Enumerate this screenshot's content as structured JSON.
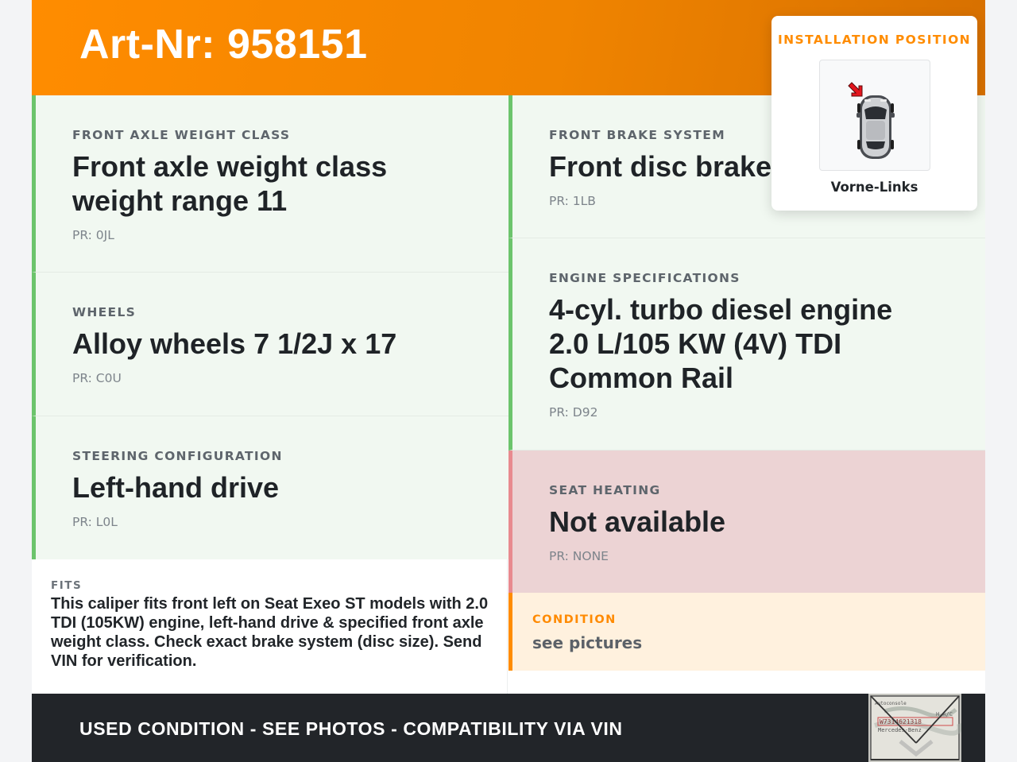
{
  "header": {
    "art_number": "Art-Nr: 958151"
  },
  "specs": [
    {
      "label": "FRONT AXLE WEIGHT CLASS",
      "value": "Front axle weight class weight range 11",
      "pr": "PR: 0JL"
    },
    {
      "label": "WHEELS",
      "value": "Alloy wheels 7 1/2J x 17",
      "pr": "PR: C0U"
    },
    {
      "label": "STEERING CONFIGURATION",
      "value": "Left-hand drive",
      "pr": "PR: L0L"
    },
    {
      "label": "FRONT BRAKE SYSTEM",
      "value": "Front disc brakes",
      "pr": "PR: 1LB"
    },
    {
      "label": "ENGINE SPECIFICATIONS",
      "value": "4-cyl. turbo diesel engine 2.0 L/105 KW (4V) TDI Common Rail",
      "pr": "PR: D92"
    },
    {
      "label": "SEAT HEATING",
      "value": "Not available",
      "pr": "PR: NONE"
    }
  ],
  "fits": {
    "label": "FITS",
    "text": "This caliper fits front left on Seat Exeo ST models with 2.0 TDI (105KW) engine, left-hand drive & specified front axle weight class. Check exact brake system (disc size). Send VIN for verification."
  },
  "condition": {
    "label": "CONDITION",
    "value": "see pictures"
  },
  "footer": {
    "text": "USED CONDITION - SEE PHOTOS - COMPATIBILITY VIA VIN",
    "label_photo": {
      "line1": "Autoconsole",
      "line2": "H  A/C",
      "code": "W7314621318",
      "brand": "Mercedes-Benz"
    }
  },
  "installation": {
    "title": "INSTALLATION POSITION",
    "position": "Vorne-Links",
    "colors": {
      "arrow": "#e3151d",
      "accent": "#ff8c00"
    }
  },
  "colors": {
    "header_orange": "#ff8c00",
    "available_green": "#6cc46c",
    "unavailable_red": "#e88a8f",
    "footer_dark": "#222529"
  }
}
